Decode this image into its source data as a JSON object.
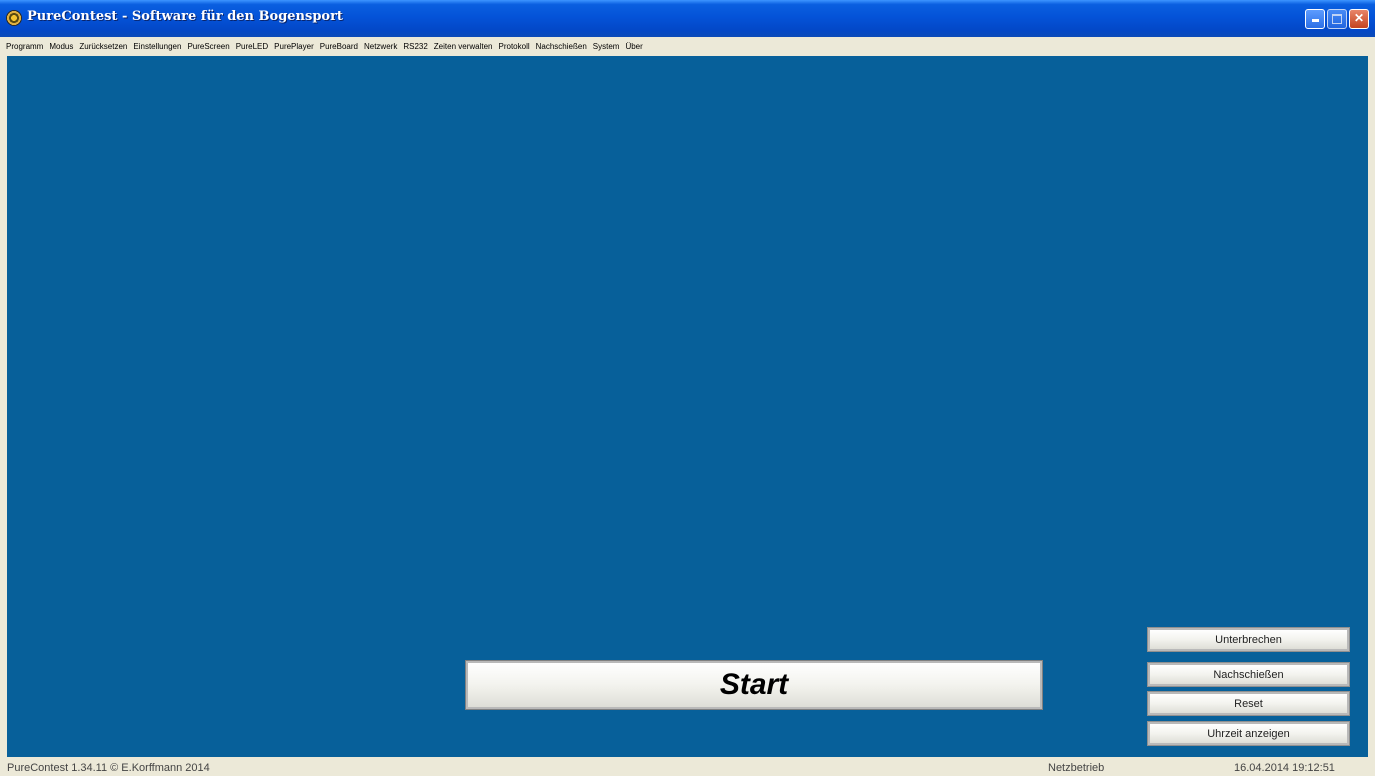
{
  "window": {
    "title": "PureContest - Software für den Bogensport",
    "minimize_label": "",
    "maximize_label": "",
    "close_label": "✕"
  },
  "menu": {
    "items": [
      {
        "label": "Programm"
      },
      {
        "label": "Modus"
      },
      {
        "label": "Zurücksetzen"
      },
      {
        "label": "Einstellungen"
      },
      {
        "label": "PureScreen"
      },
      {
        "label": "PureLED"
      },
      {
        "label": "PurePlayer"
      },
      {
        "label": "PureBoard"
      },
      {
        "label": "Netzwerk"
      },
      {
        "label": "RS232"
      },
      {
        "label": "Zeiten verwalten"
      },
      {
        "label": "Protokoll"
      },
      {
        "label": "Nachschießen"
      },
      {
        "label": "System"
      },
      {
        "label": "Über"
      }
    ]
  },
  "main": {
    "background_color": "#07609A",
    "start_label": "Start",
    "side_buttons": {
      "unterbrechen": "Unterbrechen",
      "nachschiessen": "Nachschießen",
      "reset": "Reset",
      "uhrzeit": "Uhrzeit anzeigen"
    }
  },
  "status": {
    "version": "PureContest 1.34.11 © E.Korffmann 2014",
    "mode": "Netzbetrieb",
    "datetime": "16.04.2014 19:12:51"
  }
}
